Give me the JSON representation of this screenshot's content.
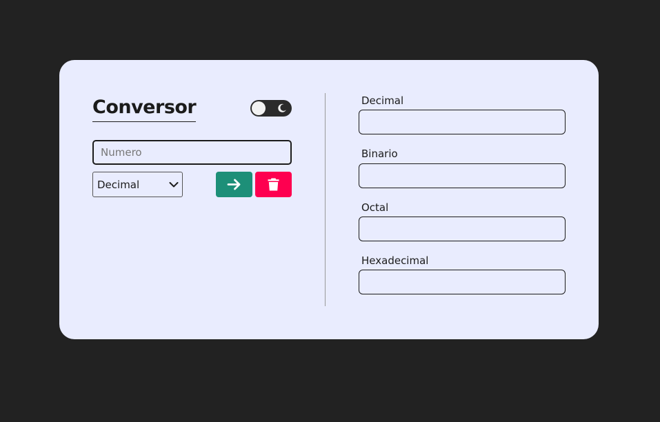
{
  "app": {
    "title": "Conversor"
  },
  "theme_toggle": {
    "icon": "moon-icon",
    "state": "light"
  },
  "input": {
    "placeholder": "Numero",
    "value": ""
  },
  "base_select": {
    "selected": "Decimal"
  },
  "buttons": {
    "convert_icon": "arrow-right-icon",
    "clear_icon": "trash-icon"
  },
  "outputs": [
    {
      "label": "Decimal",
      "value": ""
    },
    {
      "label": "Binario",
      "value": ""
    },
    {
      "label": "Octal",
      "value": ""
    },
    {
      "label": "Hexadecimal",
      "value": ""
    }
  ],
  "colors": {
    "background": "#222222",
    "card": "#e9ecfe",
    "convert_button": "#1d8f78",
    "clear_button": "#fe0050"
  }
}
